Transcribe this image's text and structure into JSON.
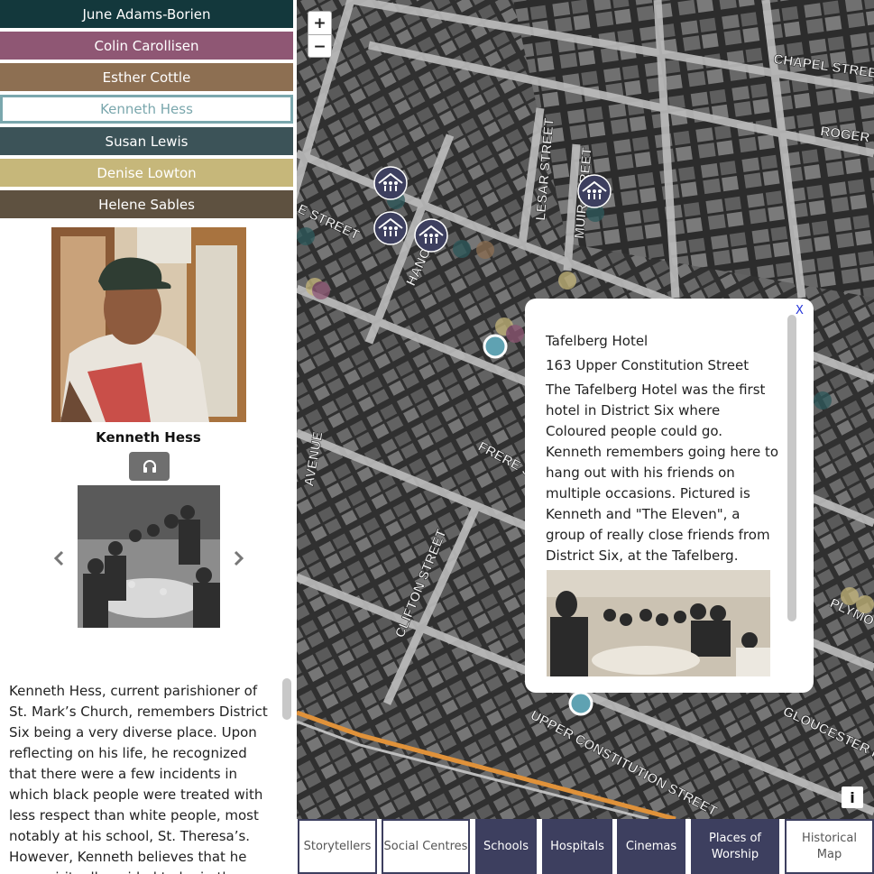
{
  "storytellers": [
    {
      "name": "June Adams-Borien",
      "color": "#13383c",
      "active": false
    },
    {
      "name": "Colin Carollisen",
      "color": "#8f5774",
      "active": false
    },
    {
      "name": "Esther Cottle",
      "color": "#8d6f52",
      "active": false
    },
    {
      "name": "Kenneth Hess",
      "color": "#7aa7ad",
      "active": true
    },
    {
      "name": "Susan Lewis",
      "color": "#3c5358",
      "active": false
    },
    {
      "name": "Denise Lowton",
      "color": "#c6b77a",
      "active": false
    },
    {
      "name": "Helene Sables",
      "color": "#5e5140",
      "active": false
    }
  ],
  "profile": {
    "name": "Kenneth Hess",
    "bio": "Kenneth Hess, current parishioner of St. Mark’s Church, remembers District Six being a very diverse place. Upon reflecting on his life, he recognized that there were a few incidents in which black people were treated with less respect than white people, most notably at his school, St. Theresa’s. However, Kenneth believes that he was spiritually guided to be in these"
  },
  "icons": {
    "audio": "headphones-icon",
    "prev": "chevron-left-icon",
    "next": "chevron-right-icon",
    "marker": "place-of-worship-icon",
    "info": "info-icon"
  },
  "map": {
    "zoom_in": "+",
    "zoom_out": "−",
    "streets": [
      "CHAPEL STREE",
      "ROGER S",
      "LESAR STREET",
      "MUIR STREET",
      "HANO",
      "E STREET",
      "AVENUE",
      "FRERE S",
      "CLIFTON STREET",
      "UPPER CONSTITUTION STREET",
      "GLOUCESTER R",
      "PLYMO"
    ],
    "info_label": "i"
  },
  "popup": {
    "close": "X",
    "title": "Tafelberg Hotel",
    "address": "163 Upper Constitution Street",
    "description": "The Tafelberg Hotel was the first hotel in District Six where Coloured people could go. Kenneth remembers going here to hang out with his friends on multiple occasions. Pictured is Kenneth and \"The Eleven\", a group of really close friends from District Six, at the Tafelberg."
  },
  "nav": [
    {
      "label": "Storytellers",
      "style": "light"
    },
    {
      "label": "Social Centres",
      "style": "light"
    },
    {
      "label": "Schools",
      "style": "dark"
    },
    {
      "label": "Hospitals",
      "style": "dark"
    },
    {
      "label": "Cinemas",
      "style": "dark"
    },
    {
      "label": "Places of Worship",
      "style": "dark"
    },
    {
      "label": "Historical Map",
      "style": "light"
    }
  ],
  "colors": {
    "nav_dark": "#3d3f5f",
    "marker": "#3d3f5f",
    "highlight": "#7aa7ad"
  }
}
